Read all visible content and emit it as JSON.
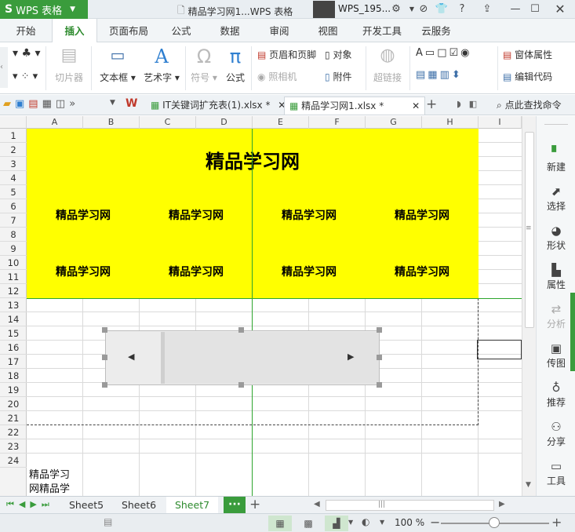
{
  "titlebar": {
    "app_name": "WPS 表格",
    "app_logo": "S",
    "doc_title": "精品学习网1...WPS 表格",
    "user_name": "WPS_195...",
    "help": "?"
  },
  "menu": {
    "tabs": [
      "开始",
      "插入",
      "页面布局",
      "公式",
      "数据",
      "审阅",
      "视图",
      "开发工具",
      "云服务"
    ],
    "active_tab": "插入"
  },
  "ribbon": {
    "clip_art": "切片器",
    "textbox": "文本框",
    "wordart": "艺术字",
    "symbol": "符号",
    "formula": "公式",
    "header_footer": "页眉和页脚",
    "object": "对象",
    "camera": "照相机",
    "attachment": "附件",
    "hyperlink": "超链接",
    "form_properties": "窗体属性",
    "edit_code": "编辑代码"
  },
  "doctabs": {
    "tab1": "IT关键词扩充表(1).xlsx *",
    "tab2": "精品学习网1.xlsx *",
    "search": "点此查找命令"
  },
  "grid": {
    "columns": [
      "A",
      "B",
      "C",
      "D",
      "E",
      "F",
      "G",
      "H",
      "I"
    ],
    "rows": [
      "1",
      "2",
      "3",
      "4",
      "5",
      "6",
      "7",
      "8",
      "9",
      "10",
      "11",
      "12",
      "13",
      "14",
      "15",
      "16",
      "17",
      "18",
      "19",
      "20",
      "21",
      "22",
      "23",
      "24"
    ],
    "title_text": "精品学习网",
    "label_text": "精品学习网",
    "cell_text_line1": "精品学习",
    "cell_text_line2": "网精品学",
    "highlight_color": "#ffff00"
  },
  "right_panel": {
    "items": [
      "新建",
      "选择",
      "形状",
      "属性",
      "分析",
      "传图",
      "推荐",
      "分享",
      "工具"
    ]
  },
  "sheets": {
    "tabs": [
      "Sheet5",
      "Sheet6",
      "Sheet7"
    ],
    "active": "Sheet7",
    "more": "···",
    "add": "+"
  },
  "status": {
    "zoom": "100 %",
    "accent": "#3a9c3c"
  }
}
